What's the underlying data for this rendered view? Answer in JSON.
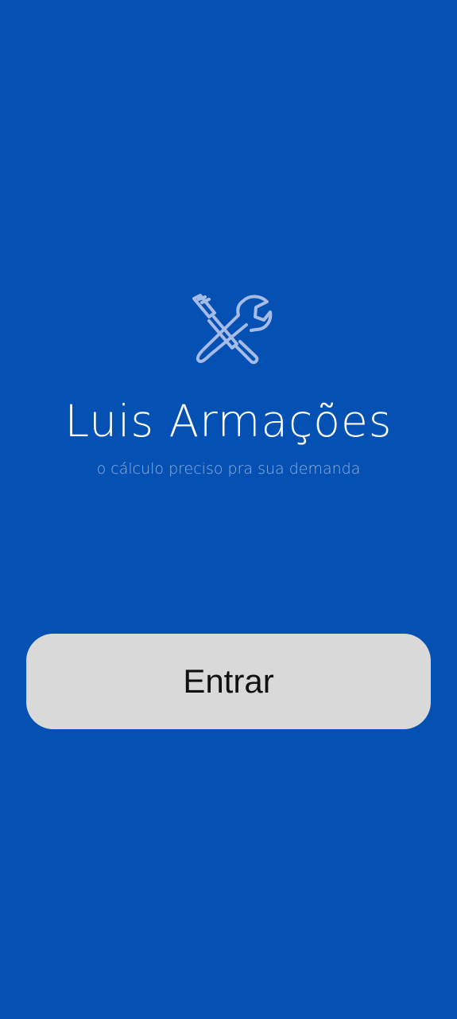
{
  "logo": {
    "icon": "tools-icon",
    "color": "#A6BCE6"
  },
  "title": "Luis Armações",
  "tagline": "o cálculo preciso pra sua demanda",
  "enter_button": {
    "label": "Entrar"
  },
  "colors": {
    "background": "#0551B3",
    "button": "#D9D9D9",
    "title": "#FFFFFF",
    "tagline": "#93B1DF"
  }
}
